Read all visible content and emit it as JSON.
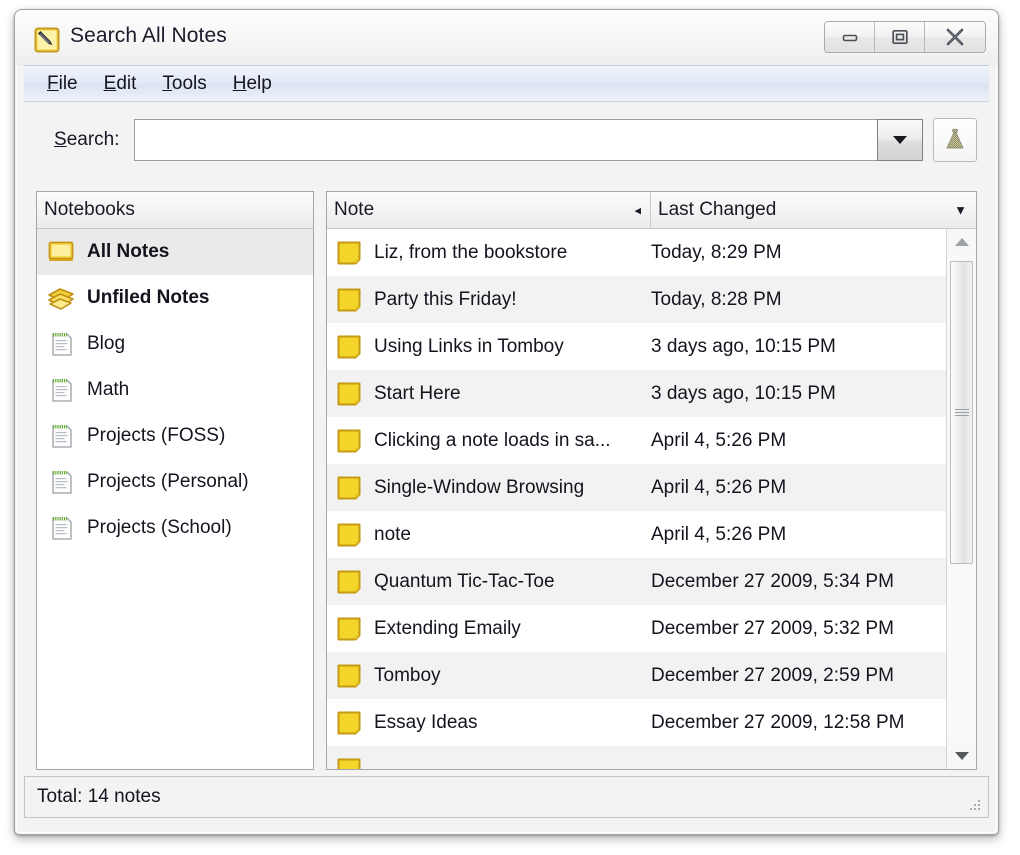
{
  "window": {
    "title": "Search All Notes",
    "app_icon": "note-pencil-icon",
    "buttons": {
      "minimize": "minimize-button",
      "maximize": "maximize-button",
      "close": "close-button"
    }
  },
  "menubar": {
    "items": [
      {
        "label": "File",
        "mnemonic": "F"
      },
      {
        "label": "Edit",
        "mnemonic": "E"
      },
      {
        "label": "Tools",
        "mnemonic": "T"
      },
      {
        "label": "Help",
        "mnemonic": "H"
      }
    ]
  },
  "search": {
    "label": "Search:",
    "mnemonic": "S",
    "value": "",
    "placeholder": "",
    "dropdown_icon": "chevron-down-icon",
    "tool_icon": "notebook-tool-icon"
  },
  "notebooks": {
    "header": "Notebooks",
    "items": [
      {
        "label": "All Notes",
        "icon": "all-notes-icon",
        "bold": true,
        "selected": true
      },
      {
        "label": "Unfiled Notes",
        "icon": "unfiled-notes-icon",
        "bold": true,
        "selected": false
      },
      {
        "label": "Blog",
        "icon": "notebook-icon",
        "bold": false,
        "selected": false
      },
      {
        "label": "Math",
        "icon": "notebook-icon",
        "bold": false,
        "selected": false
      },
      {
        "label": "Projects (FOSS)",
        "icon": "notebook-icon",
        "bold": false,
        "selected": false
      },
      {
        "label": "Projects (Personal)",
        "icon": "notebook-icon",
        "bold": false,
        "selected": false
      },
      {
        "label": "Projects (School)",
        "icon": "notebook-icon",
        "bold": false,
        "selected": false
      }
    ]
  },
  "notes": {
    "columns": [
      {
        "label": "Note",
        "sort_indicator": "◂"
      },
      {
        "label": "Last Changed",
        "sort_indicator": "▼"
      }
    ],
    "rows": [
      {
        "title": "Liz, from the bookstore",
        "changed": "Today, 8:29 PM"
      },
      {
        "title": "Party this Friday!",
        "changed": "Today, 8:28 PM"
      },
      {
        "title": "Using Links in Tomboy",
        "changed": "3 days ago, 10:15 PM"
      },
      {
        "title": "Start Here",
        "changed": "3 days ago, 10:15 PM"
      },
      {
        "title": "Clicking a note loads in sa...",
        "changed": "April 4, 5:26 PM"
      },
      {
        "title": "Single-Window Browsing",
        "changed": "April 4, 5:26 PM"
      },
      {
        "title": "note",
        "changed": "April 4, 5:26 PM"
      },
      {
        "title": "Quantum Tic-Tac-Toe",
        "changed": "December 27 2009, 5:34 PM"
      },
      {
        "title": "Extending Emaily",
        "changed": "December 27 2009, 5:32 PM"
      },
      {
        "title": "Tomboy",
        "changed": "December 27 2009, 2:59 PM"
      },
      {
        "title": "Essay Ideas",
        "changed": "December 27 2009, 12:58 PM"
      },
      {
        "title": "",
        "changed": ""
      }
    ],
    "scrollbar": {
      "up_icon": "triangle-up-icon",
      "down_icon": "triangle-down-icon"
    }
  },
  "statusbar": {
    "text": "Total: 14 notes"
  },
  "colors": {
    "note_yellow": "#f2d93b",
    "selection_gray": "#eaeaea",
    "alt_row": "#f2f2f2",
    "menu_blue": "#dbe4f3"
  }
}
